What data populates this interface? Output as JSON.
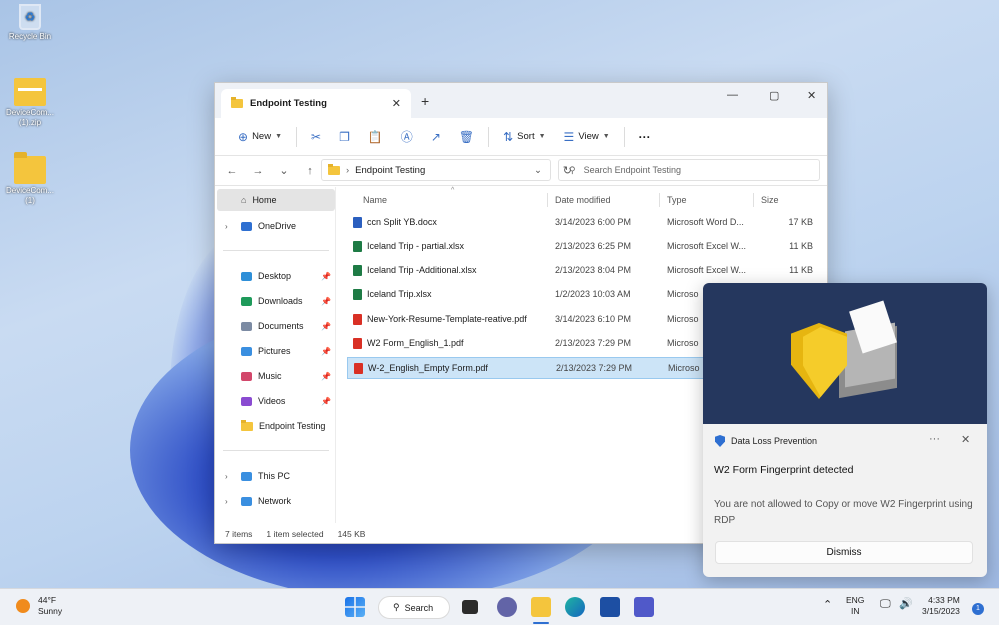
{
  "desktop": {
    "icons": [
      {
        "label": "Recycle Bin"
      },
      {
        "label": "DeviceCom...\n(1).zip"
      },
      {
        "label": "DeviceCom...\n(1)"
      }
    ]
  },
  "explorer": {
    "tab_title": "Endpoint Testing",
    "toolbar": {
      "new": "New",
      "sort": "Sort",
      "view": "View",
      "more": "···"
    },
    "address": {
      "crumb": "Endpoint Testing"
    },
    "search": {
      "placeholder": "Search Endpoint Testing"
    },
    "sidebar": {
      "home": "Home",
      "onedrive": "OneDrive",
      "quick": [
        "Desktop",
        "Downloads",
        "Documents",
        "Pictures",
        "Music",
        "Videos",
        "Endpoint Testing"
      ],
      "thispc": "This PC",
      "network": "Network"
    },
    "columns": {
      "name": "Name",
      "date": "Date modified",
      "type": "Type",
      "size": "Size"
    },
    "files": [
      {
        "name": "ccn Split YB.docx",
        "date": "3/14/2023 6:00 PM",
        "type": "Microsoft Word D...",
        "size": "17 KB",
        "kind": "docx"
      },
      {
        "name": "Iceland Trip - partial.xlsx",
        "date": "2/13/2023 6:25 PM",
        "type": "Microsoft Excel W...",
        "size": "11 KB",
        "kind": "xlsx"
      },
      {
        "name": "Iceland Trip -Additional.xlsx",
        "date": "2/13/2023 8:04 PM",
        "type": "Microsoft Excel W...",
        "size": "11 KB",
        "kind": "xlsx"
      },
      {
        "name": "Iceland Trip.xlsx",
        "date": "1/2/2023 10:03 AM",
        "type": "Microso",
        "size": "",
        "kind": "xlsx"
      },
      {
        "name": "New-York-Resume-Template-reative.pdf",
        "date": "3/14/2023 6:10 PM",
        "type": "Microso",
        "size": "",
        "kind": "pdf"
      },
      {
        "name": "W2 Form_English_1.pdf",
        "date": "2/13/2023 7:29 PM",
        "type": "Microso",
        "size": "",
        "kind": "pdf"
      },
      {
        "name": "W-2_English_Empty Form.pdf",
        "date": "2/13/2023 7:29 PM",
        "type": "Microso",
        "size": "",
        "kind": "pdf"
      }
    ],
    "status": {
      "items": "7 items",
      "selected": "1 item selected",
      "size": "145 KB"
    }
  },
  "toast": {
    "app": "Data Loss Prevention",
    "title": "W2 Form Fingerprint detected",
    "message": "You are not allowed to Copy or move W2 Fingerprint using RDP",
    "dismiss": "Dismiss"
  },
  "taskbar": {
    "temp": "44°F",
    "condition": "Sunny",
    "search": "Search",
    "lang1": "ENG",
    "lang2": "IN",
    "time": "4:33 PM",
    "date": "3/15/2023",
    "notifications": "1"
  },
  "colors": {
    "accent": "#2e6fd1",
    "selection": "#cce4f7",
    "toast_hero": "#25375e"
  }
}
